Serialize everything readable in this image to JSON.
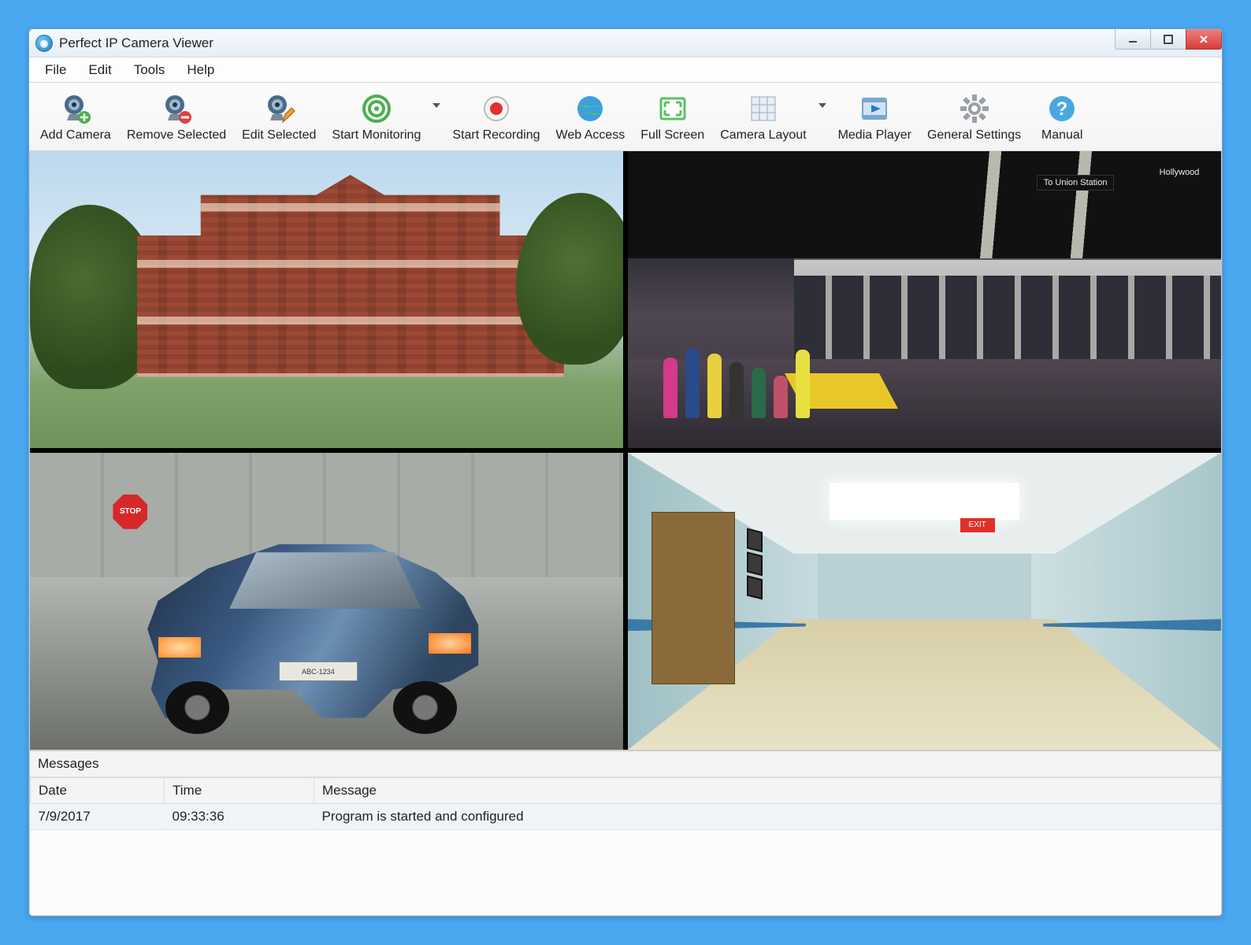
{
  "titlebar": {
    "title": "Perfect IP Camera Viewer"
  },
  "menu": {
    "file": "File",
    "edit": "Edit",
    "tools": "Tools",
    "help": "Help"
  },
  "toolbar": {
    "add_camera": "Add Camera",
    "remove_selected": "Remove Selected",
    "edit_selected": "Edit Selected",
    "start_monitoring": "Start Monitoring",
    "start_recording": "Start Recording",
    "web_access": "Web Access",
    "full_screen": "Full Screen",
    "camera_layout": "Camera Layout",
    "media_player": "Media Player",
    "general_settings": "General Settings",
    "manual": "Manual"
  },
  "cameras": {
    "feeds": [
      {
        "id": "cam1",
        "scene": "brick-building-campus"
      },
      {
        "id": "cam2",
        "scene": "subway-platform",
        "sign1": "To Union Station",
        "sign2": "Hollywood"
      },
      {
        "id": "cam3",
        "scene": "parking-suv",
        "plate": "ABC-1234",
        "stop": "STOP"
      },
      {
        "id": "cam4",
        "scene": "hospital-hallway",
        "exit": "EXIT"
      }
    ]
  },
  "messages": {
    "panel_title": "Messages",
    "columns": {
      "date": "Date",
      "time": "Time",
      "message": "Message"
    },
    "rows": [
      {
        "date": "7/9/2017",
        "time": "09:33:36",
        "message": "Program is started and configured"
      }
    ]
  },
  "colors": {
    "accent_blue": "#3a8fd6",
    "close_red": "#d83a3a",
    "green": "#4caf50"
  }
}
